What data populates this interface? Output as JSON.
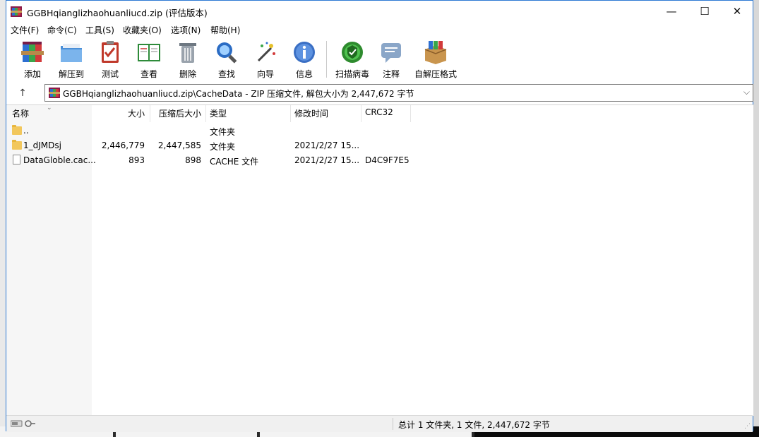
{
  "window": {
    "title": "GGBHqianglizhaohuanliucd.zip (评估版本)",
    "controls": {
      "minimize": "—",
      "maximize": "☐",
      "close": "✕"
    }
  },
  "menu": [
    "文件(F)",
    "命令(C)",
    "工具(S)",
    "收藏夹(O)",
    "选项(N)",
    "帮助(H)"
  ],
  "toolbar": [
    {
      "label": "添加",
      "icon": "add-archive-icon"
    },
    {
      "label": "解压到",
      "icon": "extract-to-icon"
    },
    {
      "label": "测试",
      "icon": "test-icon"
    },
    {
      "label": "查看",
      "icon": "view-icon"
    },
    {
      "label": "删除",
      "icon": "delete-icon"
    },
    {
      "label": "查找",
      "icon": "find-icon"
    },
    {
      "label": "向导",
      "icon": "wizard-icon"
    },
    {
      "label": "信息",
      "icon": "info-icon"
    },
    {
      "label": "扫描病毒",
      "icon": "virus-scan-icon"
    },
    {
      "label": "注释",
      "icon": "comment-icon"
    },
    {
      "label": "自解压格式",
      "icon": "sfx-icon"
    }
  ],
  "address": {
    "up": "↑",
    "path": "GGBHqianglizhaohuanliucd.zip\\CacheData - ZIP 压缩文件, 解包大小为 2,447,672 字节"
  },
  "columns": [
    "名称",
    "大小",
    "压缩后大小",
    "类型",
    "修改时间",
    "CRC32"
  ],
  "files": [
    {
      "name": "..",
      "size": "",
      "packed": "",
      "type": "文件夹",
      "modified": "",
      "crc": "",
      "kind": "folder"
    },
    {
      "name": "1_dJMDsj",
      "size": "2,446,779",
      "packed": "2,447,585",
      "type": "文件夹",
      "modified": "2021/2/27 15...",
      "crc": "",
      "kind": "folder"
    },
    {
      "name": "DataGloble.cac...",
      "size": "893",
      "packed": "898",
      "type": "CACHE 文件",
      "modified": "2021/2/27 15...",
      "crc": "D4C9F7E5",
      "kind": "file"
    }
  ],
  "status": {
    "text": "总计 1 文件夹, 1 文件, 2,447,672 字节"
  },
  "colors": {
    "window_border": "#2f7bd4",
    "folder": "#f2c75c",
    "selection": "#cce8ff"
  }
}
